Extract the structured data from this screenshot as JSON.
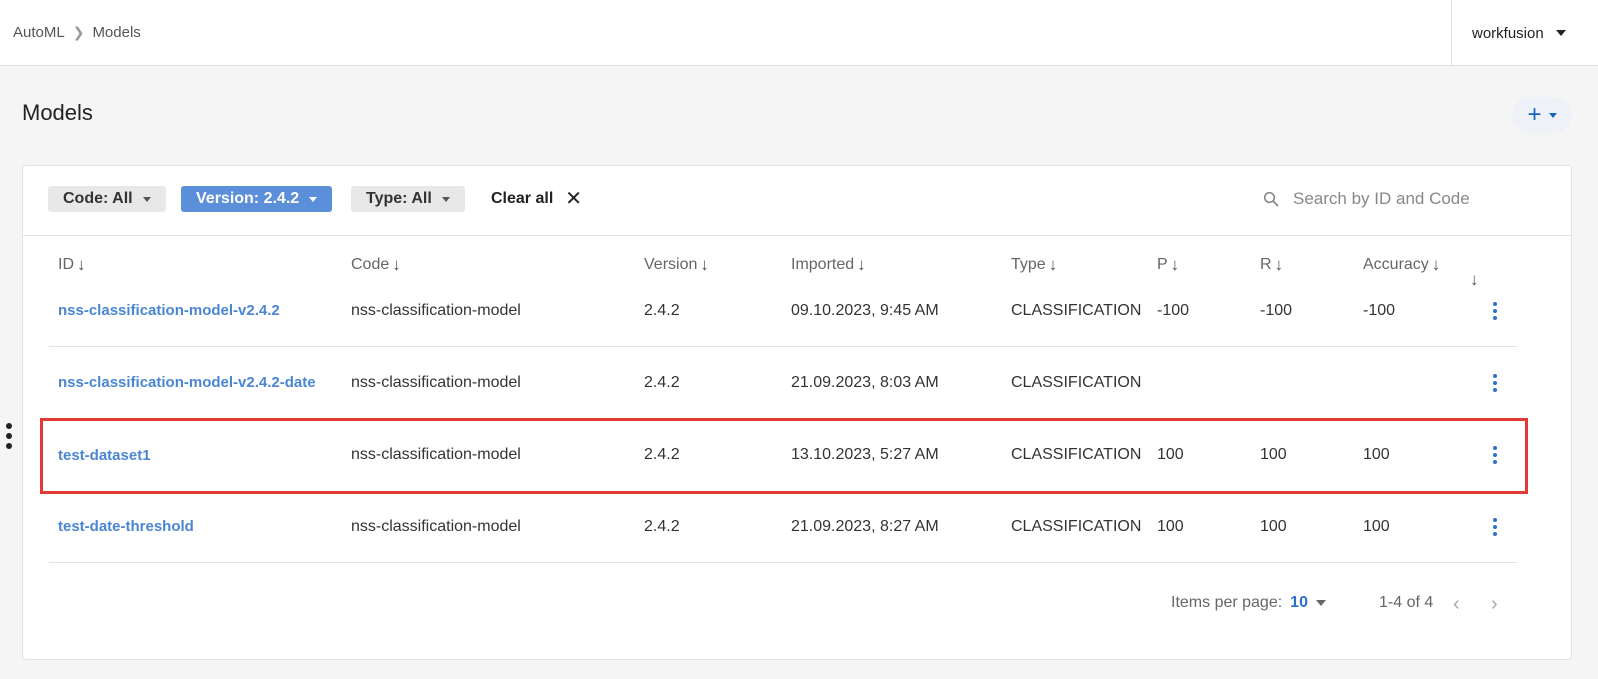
{
  "breadcrumb": {
    "root": "AutoML",
    "current": "Models"
  },
  "user": {
    "name": "workfusion"
  },
  "page": {
    "title": "Models"
  },
  "filters": {
    "code": "Code: All",
    "version": "Version: 2.4.2",
    "type": "Type: All",
    "clear": "Clear all"
  },
  "search": {
    "placeholder": "Search by ID and Code"
  },
  "columns": [
    "ID",
    "Code",
    "Version",
    "Imported",
    "Type",
    "P",
    "R",
    "Accuracy"
  ],
  "rows": [
    {
      "id": "nss-classification-model-v2.4.2",
      "code": "nss-classification-model",
      "version": "2.4.2",
      "imported": "09.10.2023, 9:45 AM",
      "type": "CLASSIFICATION",
      "p": "-100",
      "r": "-100",
      "accuracy": "-100"
    },
    {
      "id": "nss-classification-model-v2.4.2-date",
      "code": "nss-classification-model",
      "version": "2.4.2",
      "imported": "21.09.2023, 8:03 AM",
      "type": "CLASSIFICATION",
      "p": "",
      "r": "",
      "accuracy": ""
    },
    {
      "id": "test-dataset1",
      "code": "nss-classification-model",
      "version": "2.4.2",
      "imported": "13.10.2023, 5:27 AM",
      "type": "CLASSIFICATION",
      "p": "100",
      "r": "100",
      "accuracy": "100"
    },
    {
      "id": "test-date-threshold",
      "code": "nss-classification-model",
      "version": "2.4.2",
      "imported": "21.09.2023, 8:27 AM",
      "type": "CLASSIFICATION",
      "p": "100",
      "r": "100",
      "accuracy": "100"
    }
  ],
  "pagination": {
    "items_per_page_label": "Items per page:",
    "items_per_page": "10",
    "range": "1-4 of 4"
  },
  "colors": {
    "accent": "#2c6fd1",
    "link": "#4a86d4",
    "active_chip": "#5b8fd9",
    "highlight": "#e53935"
  },
  "icons": {
    "search": "search-icon",
    "sort": "arrow-down-icon",
    "more": "kebab-icon",
    "clear": "close-icon"
  }
}
